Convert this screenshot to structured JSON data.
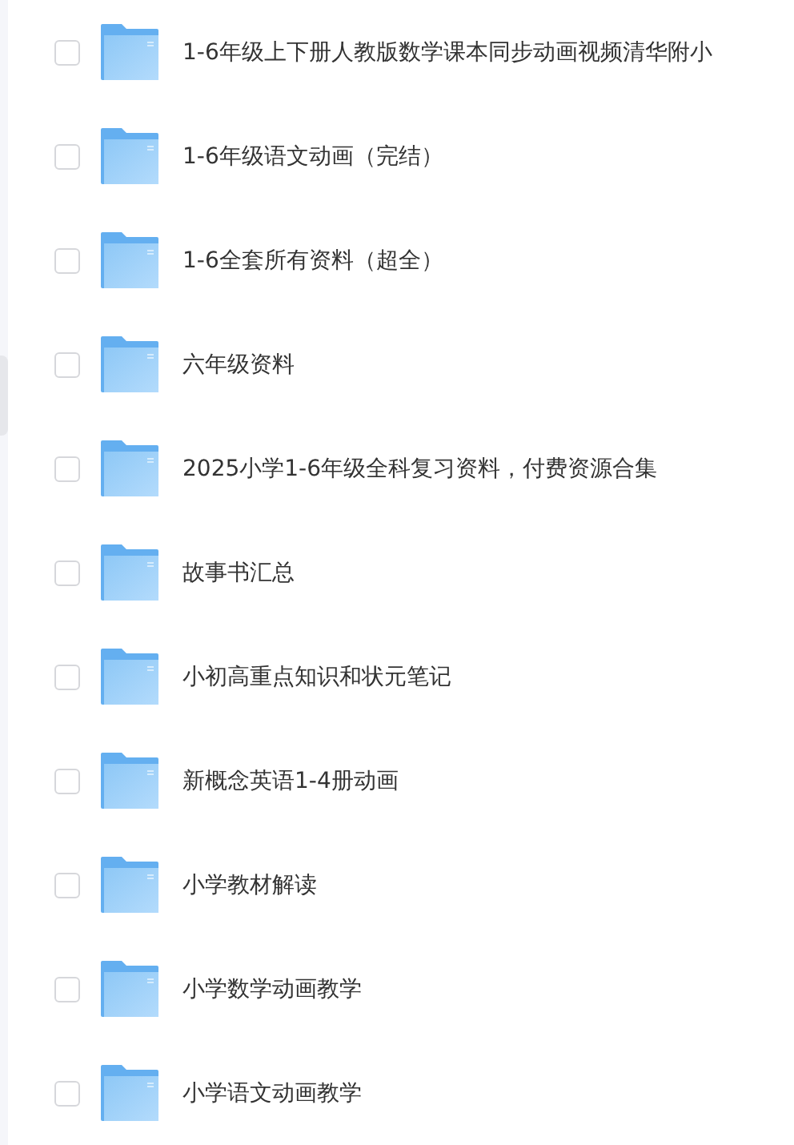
{
  "files": [
    {
      "name": "1-6年级上下册人教版数学课本同步动画视频清华附小",
      "checked": false
    },
    {
      "name": "1-6年级语文动画（完结）",
      "checked": false
    },
    {
      "name": "1-6全套所有资料（超全）",
      "checked": false
    },
    {
      "name": "六年级资料",
      "checked": false
    },
    {
      "name": "2025小学1-6年级全科复习资料，付费资源合集",
      "checked": false
    },
    {
      "name": "故事书汇总",
      "checked": false
    },
    {
      "name": "小初高重点知识和状元笔记",
      "checked": false
    },
    {
      "name": "新概念英语1-4册动画",
      "checked": false
    },
    {
      "name": "小学教材解读",
      "checked": false
    },
    {
      "name": "小学数学动画教学",
      "checked": false
    },
    {
      "name": "小学语文动画教学",
      "checked": false
    }
  ]
}
